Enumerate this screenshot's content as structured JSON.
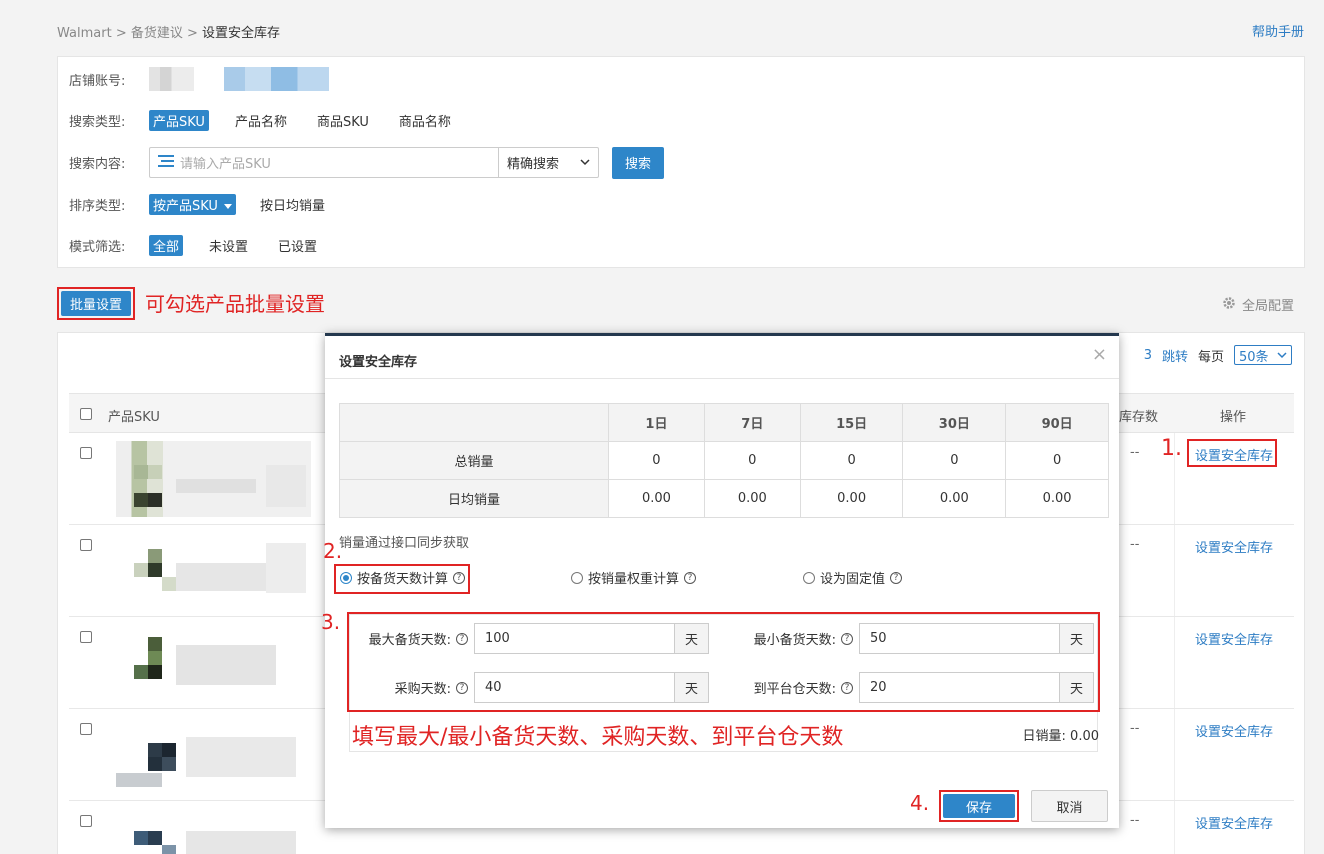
{
  "breadcrumb": {
    "root": "Walmart",
    "sep1": " > ",
    "mid": "备货建议",
    "sep2": " > ",
    "current": "设置安全库存"
  },
  "help": "帮助手册",
  "filters": {
    "store_label": "店铺账号:",
    "search_type_label": "搜索类型:",
    "search_types": [
      "产品SKU",
      "产品名称",
      "商品SKU",
      "商品名称"
    ],
    "search_content_label": "搜索内容:",
    "search_placeholder": "请输入产品SKU",
    "search_mode": "精确搜索",
    "search_button": "搜索",
    "sort_label": "排序类型:",
    "sort_active": "按产品SKU",
    "sort_other": "按日均销量",
    "mode_label": "模式筛选:",
    "modes": [
      "全部",
      "未设置",
      "已设置"
    ]
  },
  "batch_button": "批量设置",
  "annotations": {
    "batch": "可勾选产品批量设置",
    "step1": "1.",
    "step2": "2.",
    "step3": "3.",
    "step4": "4.",
    "fill_note": "填写最大/最小备货天数、采购天数、到平台仓天数"
  },
  "global_config": "全局配置",
  "pager": {
    "page_partial": "3",
    "jump": "跳转",
    "per_page": "每页",
    "per_page_value": "50条"
  },
  "table": {
    "col_sku": "产品SKU",
    "col_stock": "载库存数",
    "col_ops": "操作",
    "rows": [
      {
        "stock": "--",
        "op": "设置安全库存"
      },
      {
        "stock": "--",
        "op": "设置安全库存"
      },
      {
        "stock": "",
        "op": "设置安全库存"
      },
      {
        "stock": "--",
        "op": "设置安全库存"
      },
      {
        "stock": "--",
        "op": "设置安全库存"
      }
    ]
  },
  "modal": {
    "title": "设置安全库存",
    "close": "×",
    "stats_headers": [
      "1日",
      "7日",
      "15日",
      "30日",
      "90日"
    ],
    "total_sales_label": "总销量",
    "total_sales": [
      "0",
      "0",
      "0",
      "0",
      "0"
    ],
    "daily_sales_label": "日均销量",
    "daily_sales": [
      "0.00",
      "0.00",
      "0.00",
      "0.00",
      "0.00"
    ],
    "sync_note": "销量通过接口同步获取",
    "calc_options": [
      "按备货天数计算",
      "按销量权重计算",
      "设为固定值"
    ],
    "max_days_label": "最大备货天数:",
    "max_days": "100",
    "min_days_label": "最小备货天数:",
    "min_days": "50",
    "purchase_days_label": "采购天数:",
    "purchase_days": "40",
    "transit_days_label": "到平台仓天数:",
    "transit_days": "20",
    "unit": "天",
    "daily_result": "日销量: 0.00",
    "save": "保存",
    "cancel": "取消"
  }
}
